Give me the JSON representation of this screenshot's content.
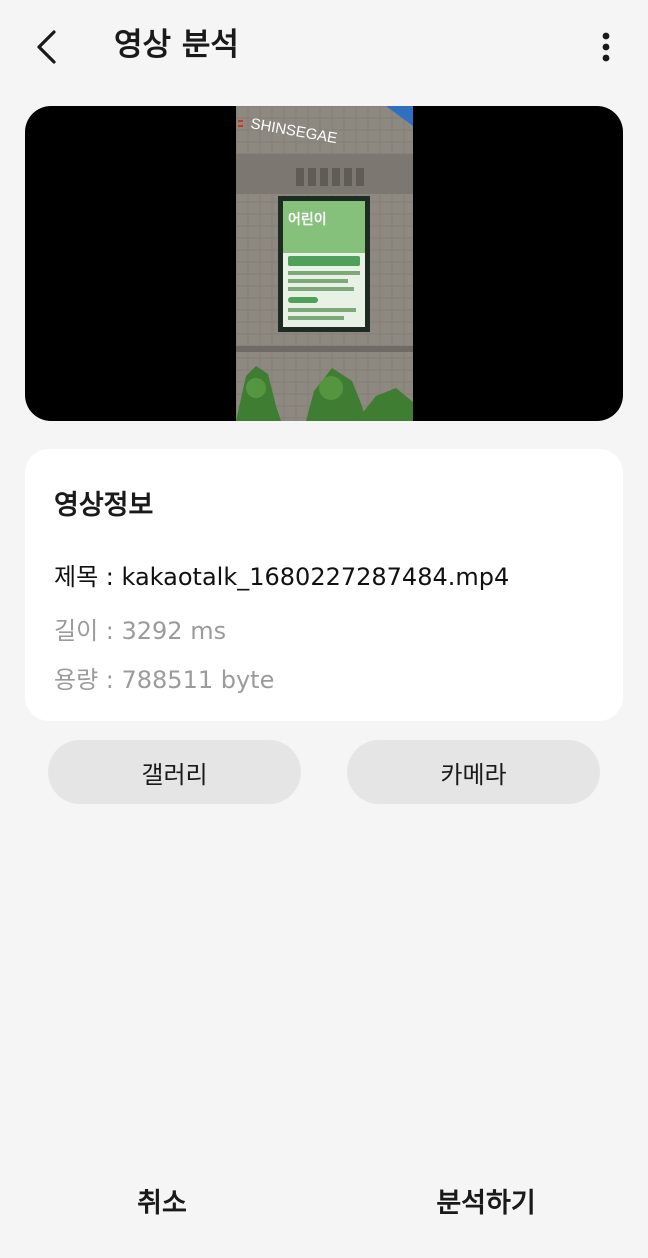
{
  "header": {
    "title": "영상 분석",
    "back_icon": "chevron-left-icon",
    "more_icon": "more-vertical-icon"
  },
  "video": {
    "signage_text": "SHINSEGAE",
    "banner_headline": "어린이"
  },
  "info": {
    "heading": "영상정보",
    "title_line": "제목 : kakaotalk_1680227287484.mp4",
    "duration_line": "길이 : 3292 ms",
    "size_line": "용량 : 788511 byte"
  },
  "source_buttons": {
    "gallery": "갤러리",
    "camera": "카메라"
  },
  "footer": {
    "cancel": "취소",
    "analyze": "분석하기"
  },
  "colors": {
    "background": "#f5f5f5",
    "card": "#ffffff",
    "pill": "#e5e5e5",
    "secondary_text": "#9b9b9b"
  }
}
